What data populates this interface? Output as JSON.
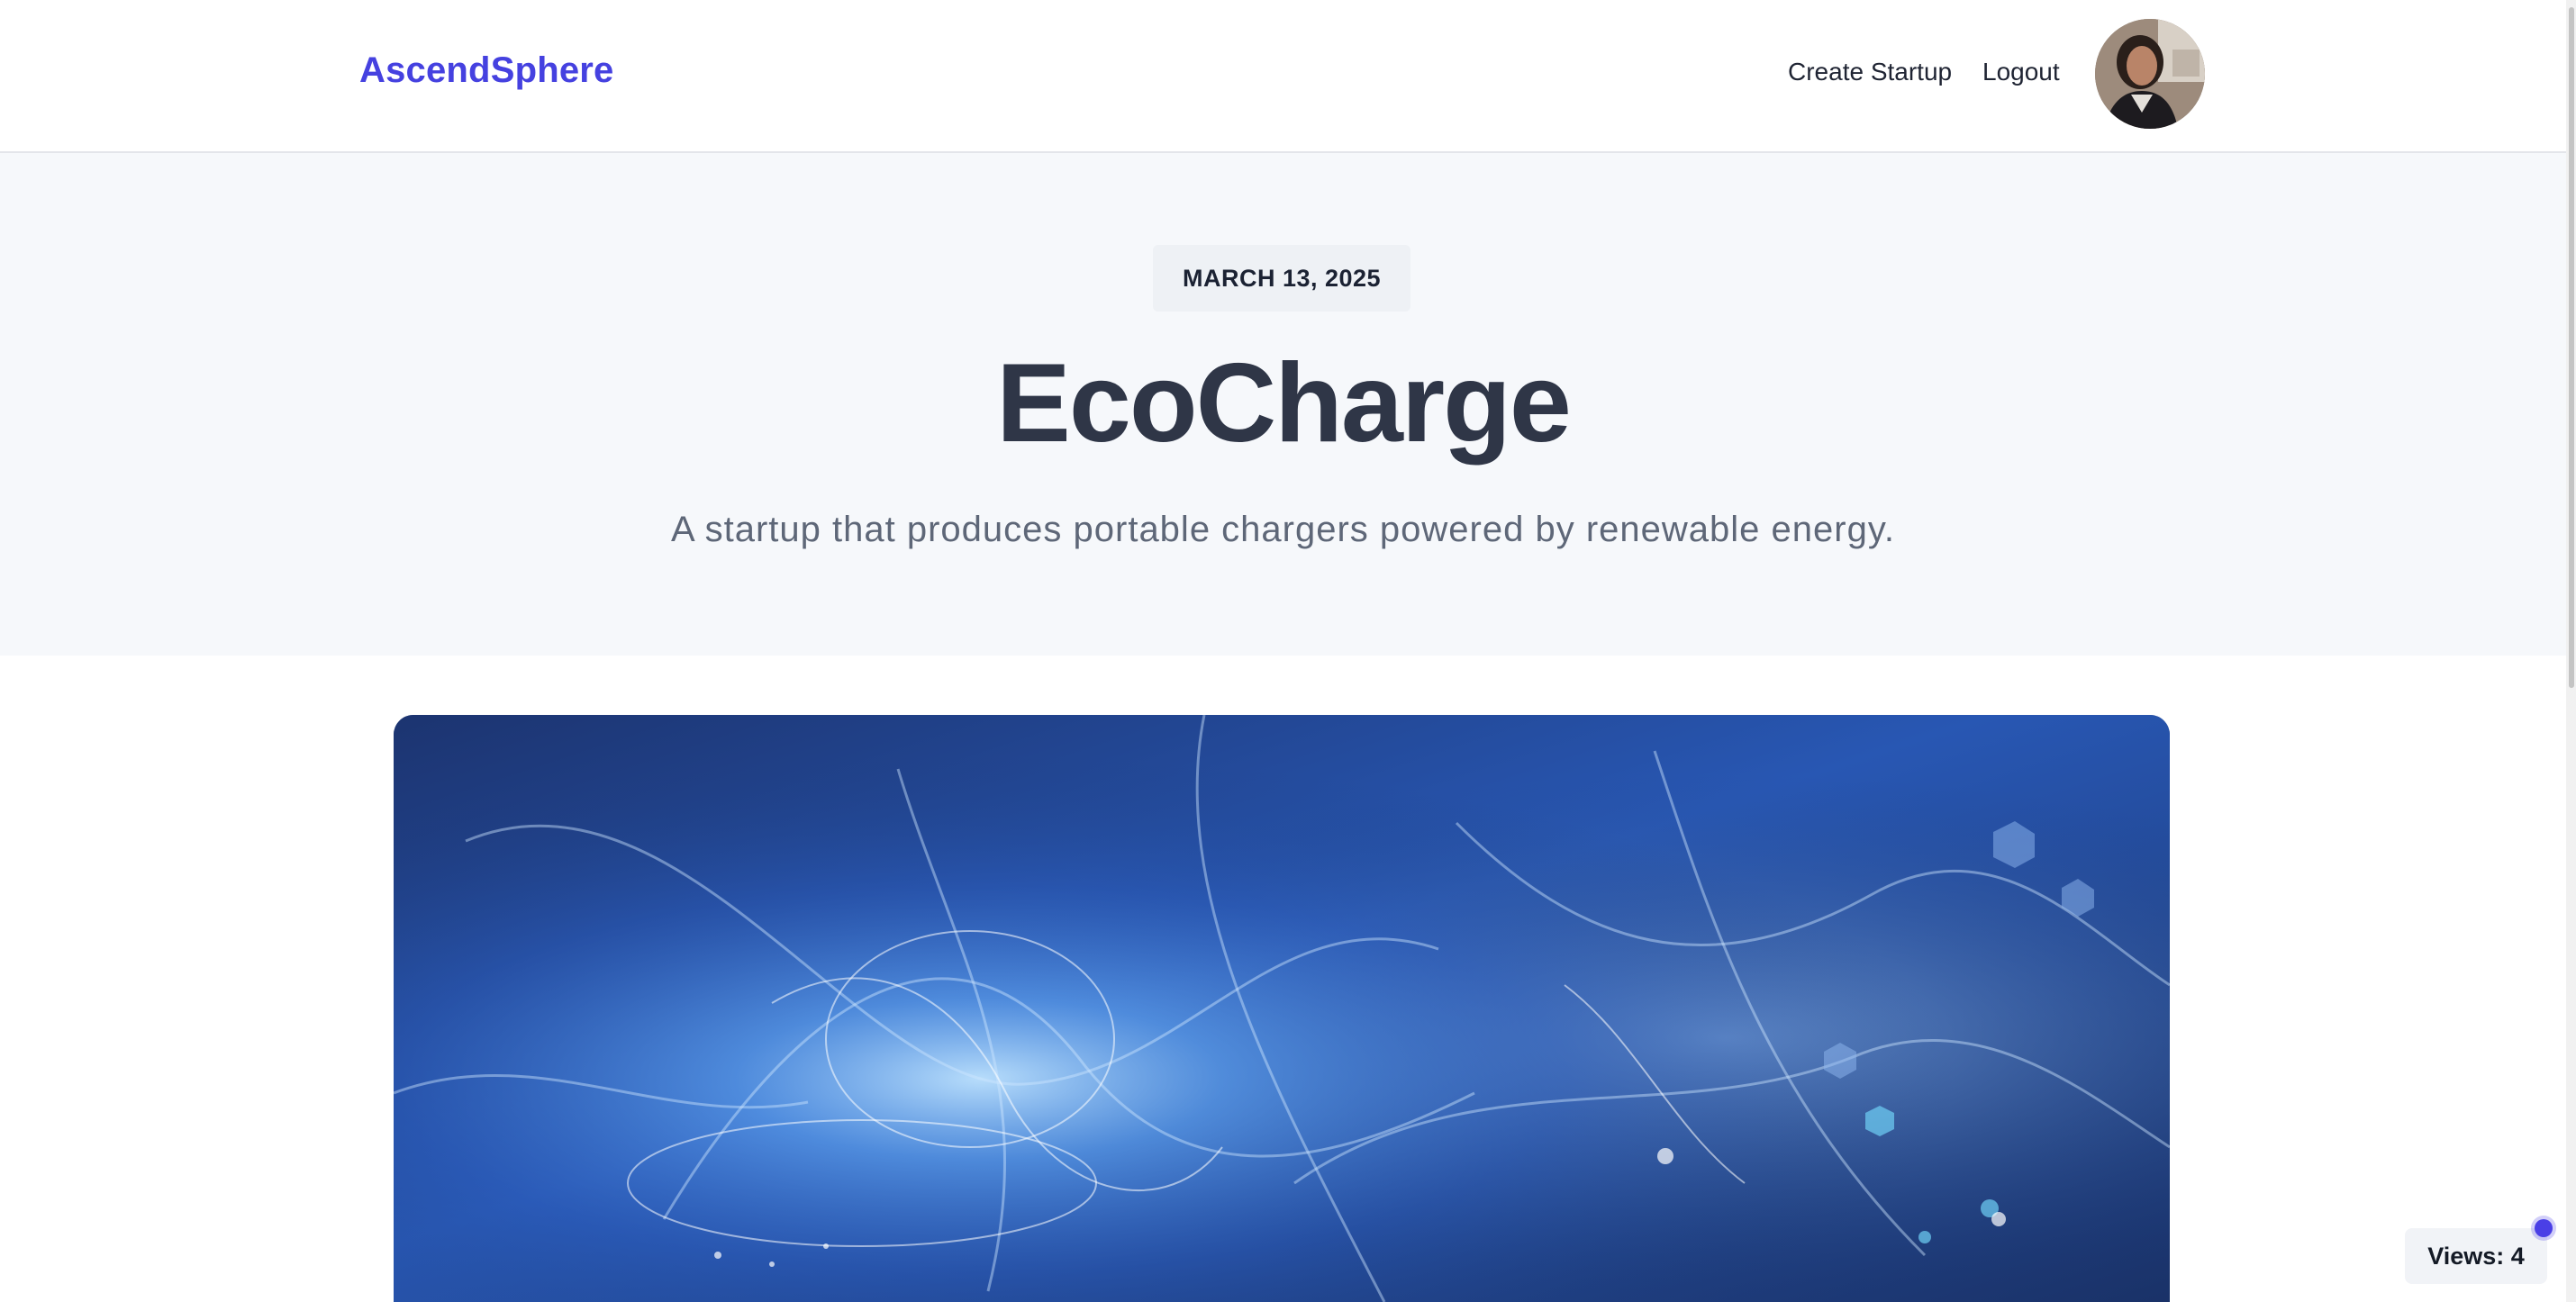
{
  "header": {
    "brand": "AscendSphere",
    "nav": {
      "create_startup": "Create Startup",
      "logout": "Logout"
    }
  },
  "hero": {
    "date": "MARCH 13, 2025",
    "title": "EcoCharge",
    "subtitle": "A startup that produces portable chargers powered by renewable energy."
  },
  "views": {
    "label": "Views: 4"
  },
  "colors": {
    "brand": "#4541e0",
    "accent_dot": "#4a3fe6",
    "hero_bg": "#f6f8fb",
    "title": "#2f3647"
  }
}
